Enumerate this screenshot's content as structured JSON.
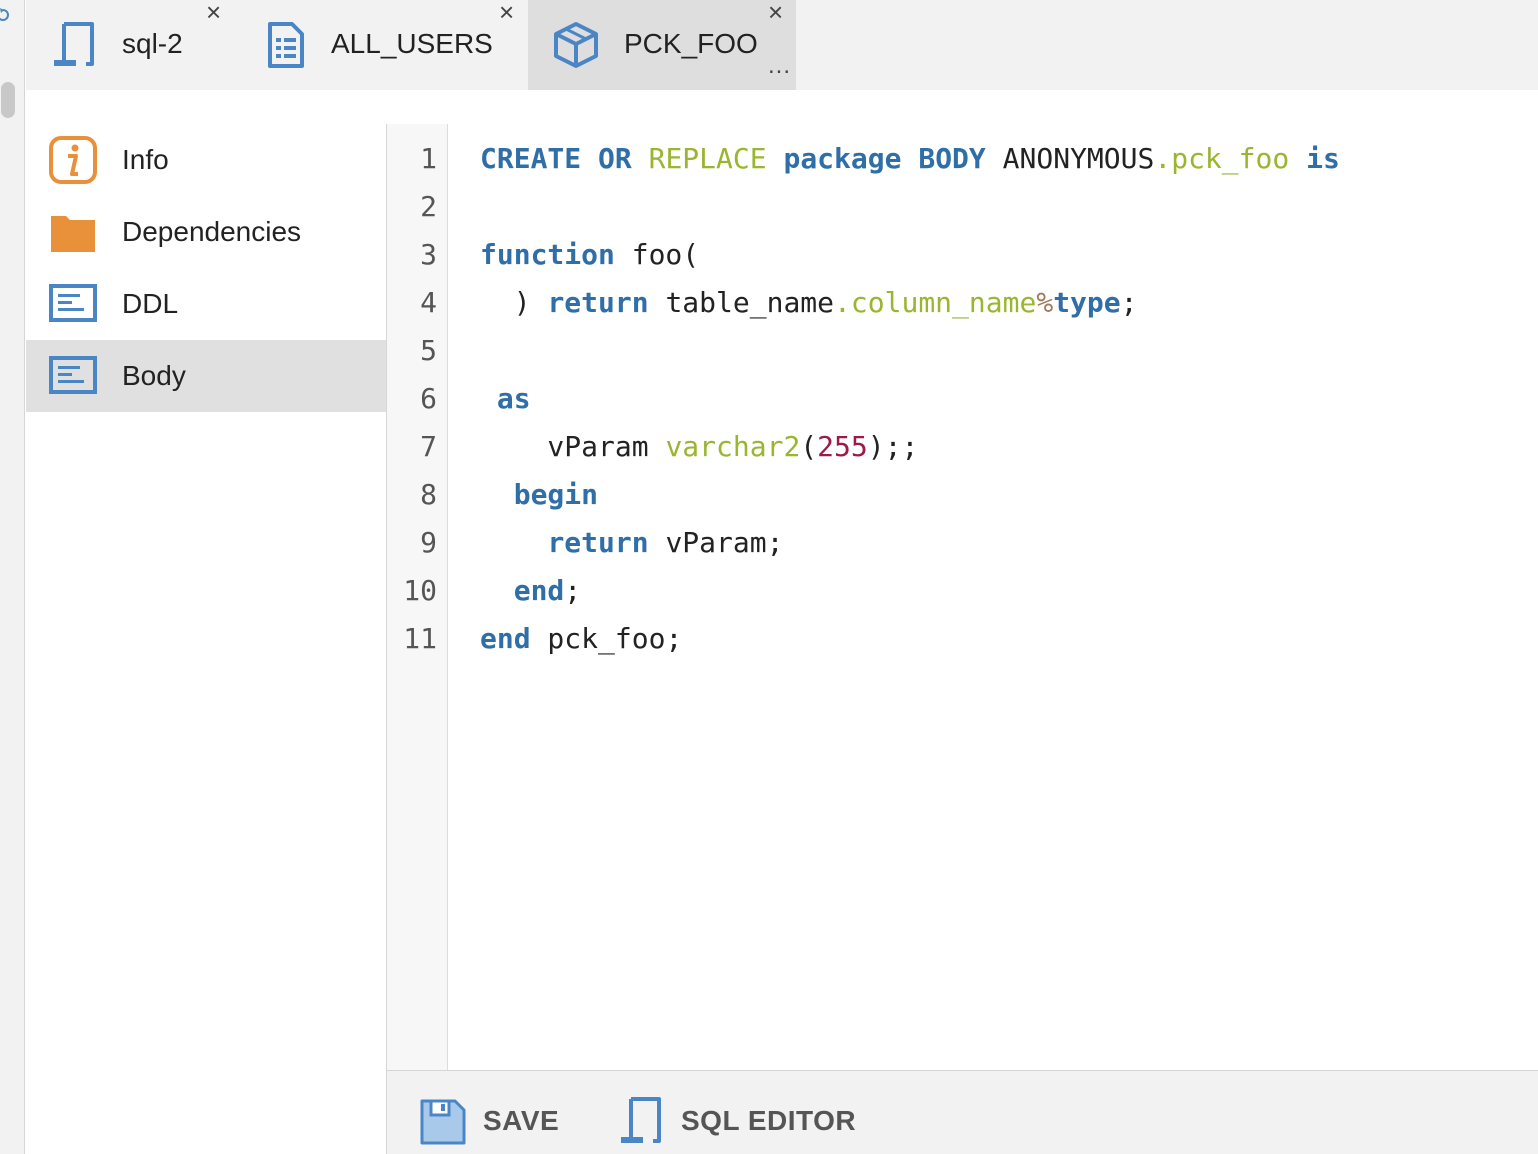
{
  "tabs": [
    {
      "label": "sql-2",
      "icon": "sql-editor-icon",
      "close": "×"
    },
    {
      "label": "ALL_USERS",
      "icon": "table-document-icon",
      "close": "×"
    },
    {
      "label": "PCK_FOO",
      "icon": "package-cube-icon",
      "close": "×",
      "more": "...",
      "active": true
    }
  ],
  "sidebar": {
    "items": [
      {
        "label": "Info",
        "icon": "info-icon"
      },
      {
        "label": "Dependencies",
        "icon": "folder-icon"
      },
      {
        "label": "DDL",
        "icon": "ddl-text-icon"
      },
      {
        "label": "Body",
        "icon": "body-text-icon",
        "active": true
      }
    ]
  },
  "editor": {
    "line_numbers": [
      "1",
      "2",
      "3",
      "4",
      "5",
      "6",
      "7",
      "8",
      "9",
      "10",
      "11"
    ],
    "lines": [
      "CREATE OR REPLACE package BODY ANONYMOUS.pck_foo is",
      "",
      "function foo(",
      "  ) return table_name.column_name%type;",
      "",
      " as",
      "    vParam varchar2(255);;",
      "  begin",
      "    return vParam;",
      "  end;",
      "end pck_foo;"
    ]
  },
  "toolbar": {
    "save_label": "SAVE",
    "sql_editor_label": "SQL EDITOR"
  },
  "colors": {
    "keyword": "#2f6ea6",
    "function": "#9ab52f",
    "number": "#9a1a4a",
    "icon_blue": "#4a86c5",
    "icon_orange": "#e8903a"
  }
}
